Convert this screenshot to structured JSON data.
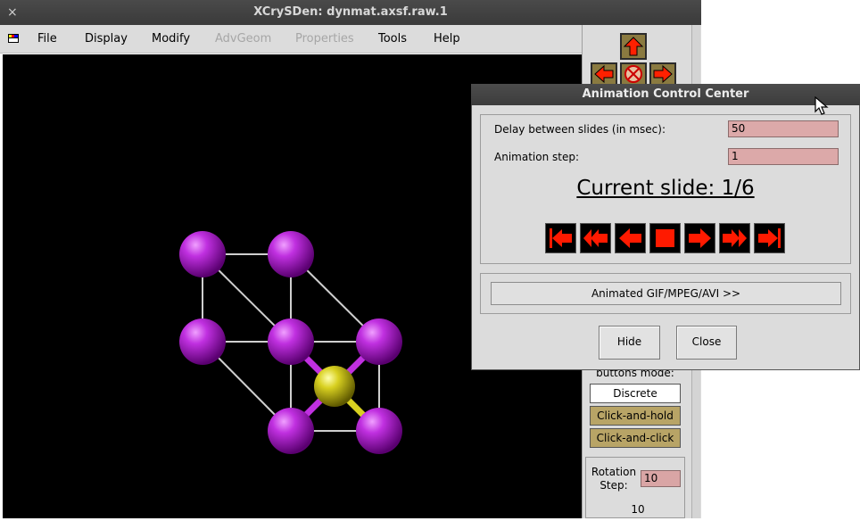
{
  "main_window": {
    "title": "XCrySDen: dynmat.axsf.raw.1",
    "close_glyph": "×"
  },
  "menu": {
    "items": [
      {
        "label": "File",
        "enabled": true
      },
      {
        "label": "Display",
        "enabled": true
      },
      {
        "label": "Modify",
        "enabled": true
      },
      {
        "label": "AdvGeom",
        "enabled": false
      },
      {
        "label": "Properties",
        "enabled": false
      },
      {
        "label": "Tools",
        "enabled": true
      },
      {
        "label": "Help",
        "enabled": true
      }
    ]
  },
  "right_panel": {
    "mode_label": "buttons mode:",
    "modes": [
      "Discrete",
      "Click-and-hold",
      "Click-and-click"
    ],
    "active_mode": "Discrete",
    "rotation_label": "Rotation Step:",
    "rotation_input": "10",
    "rotation_value": "10"
  },
  "dialog": {
    "title": "Animation Control Center",
    "delay_label": "Delay between slides (in msec):",
    "delay_value": "50",
    "step_label": "Animation step:",
    "step_value": "1",
    "current_slide": "Current slide: 1/6",
    "nav_buttons": [
      "first-slide",
      "fast-backward",
      "backward",
      "stop",
      "forward",
      "fast-forward",
      "last-slide"
    ],
    "anim_button": "Animated GIF/MPEG/AVI >>",
    "hide_button": "Hide",
    "close_button": "Close"
  },
  "colors": {
    "atom_purple": "#b020d8",
    "atom_yellow": "#d8d020",
    "button_red": "#ff0000",
    "input_pink": "#dca9a9"
  }
}
